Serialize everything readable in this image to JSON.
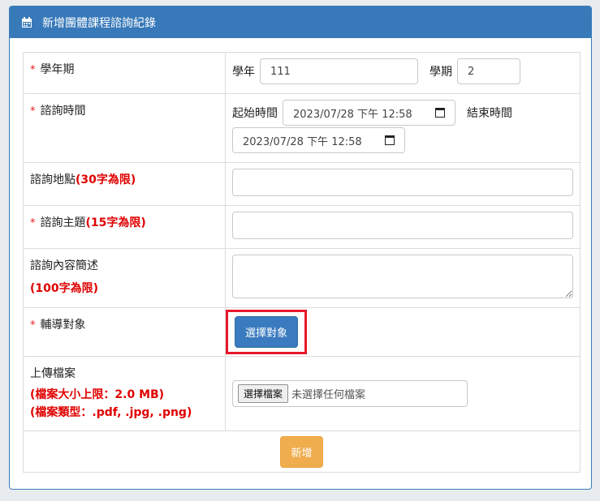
{
  "header": {
    "title": "新增團體課程諮詢紀錄",
    "icon": "calendar-icon"
  },
  "required_mark": "*",
  "rows": {
    "semester": {
      "label": "學年期",
      "year_label": "學年",
      "year_value": "111",
      "term_label": "學期",
      "term_value": "2"
    },
    "time": {
      "label": "諮詢時間",
      "start_label": "起始時間",
      "start_value": "2023/07/28 下午 12:58",
      "end_label": "結束時間",
      "end_value": "2023/07/28 下午 12:58"
    },
    "location": {
      "label": "諮詢地點",
      "limit": "(30字為限)",
      "value": ""
    },
    "topic": {
      "label": "諮詢主題",
      "limit": "(15字為限)",
      "value": ""
    },
    "content": {
      "label": "諮詢內容簡述",
      "limit": "(100字為限)",
      "value": ""
    },
    "target": {
      "label": "輔導對象",
      "button_label": "選擇對象"
    },
    "upload": {
      "label": "上傳檔案",
      "size_limit": "(檔案大小上限：2.0 MB)",
      "types": "(檔案類型：.pdf, .jpg, .png)",
      "file_button": "選擇檔案",
      "no_file_text": "未選擇任何檔案"
    }
  },
  "submit_label": "新增",
  "colors": {
    "header_bg": "#3779b9",
    "primary": "#3a7bbf",
    "warning": "#f0ad4e",
    "required": "#e02020",
    "highlight": "#e8182a"
  }
}
